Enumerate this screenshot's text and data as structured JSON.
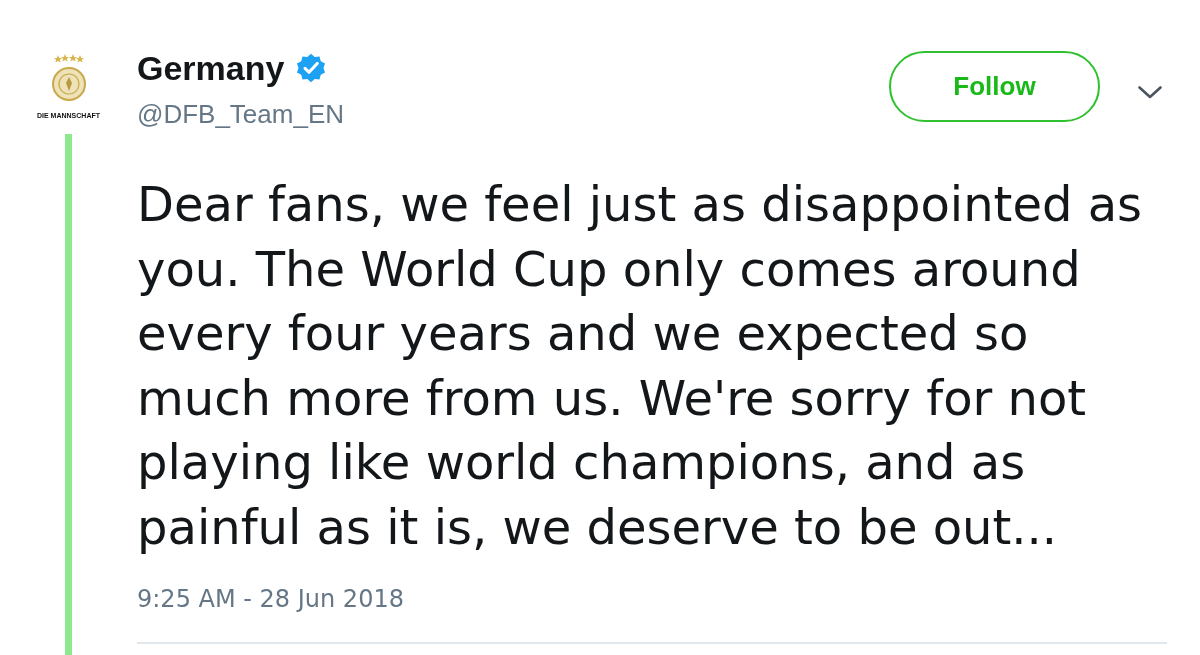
{
  "author": {
    "logo_text": "DIE MANNSCHAFT",
    "name": "Germany",
    "verified": true,
    "handle": "@DFB_Team_EN"
  },
  "follow_button": {
    "label": "Follow"
  },
  "tweet": {
    "text": "Dear fans, we feel just as disappointed as you. The World Cup only comes around every four years and we expected so much more from us. We're sorry for not playing like world champions, and as painful as it is, we deserve to be out...",
    "timestamp": "9:25 AM - 28 Jun 2018"
  }
}
